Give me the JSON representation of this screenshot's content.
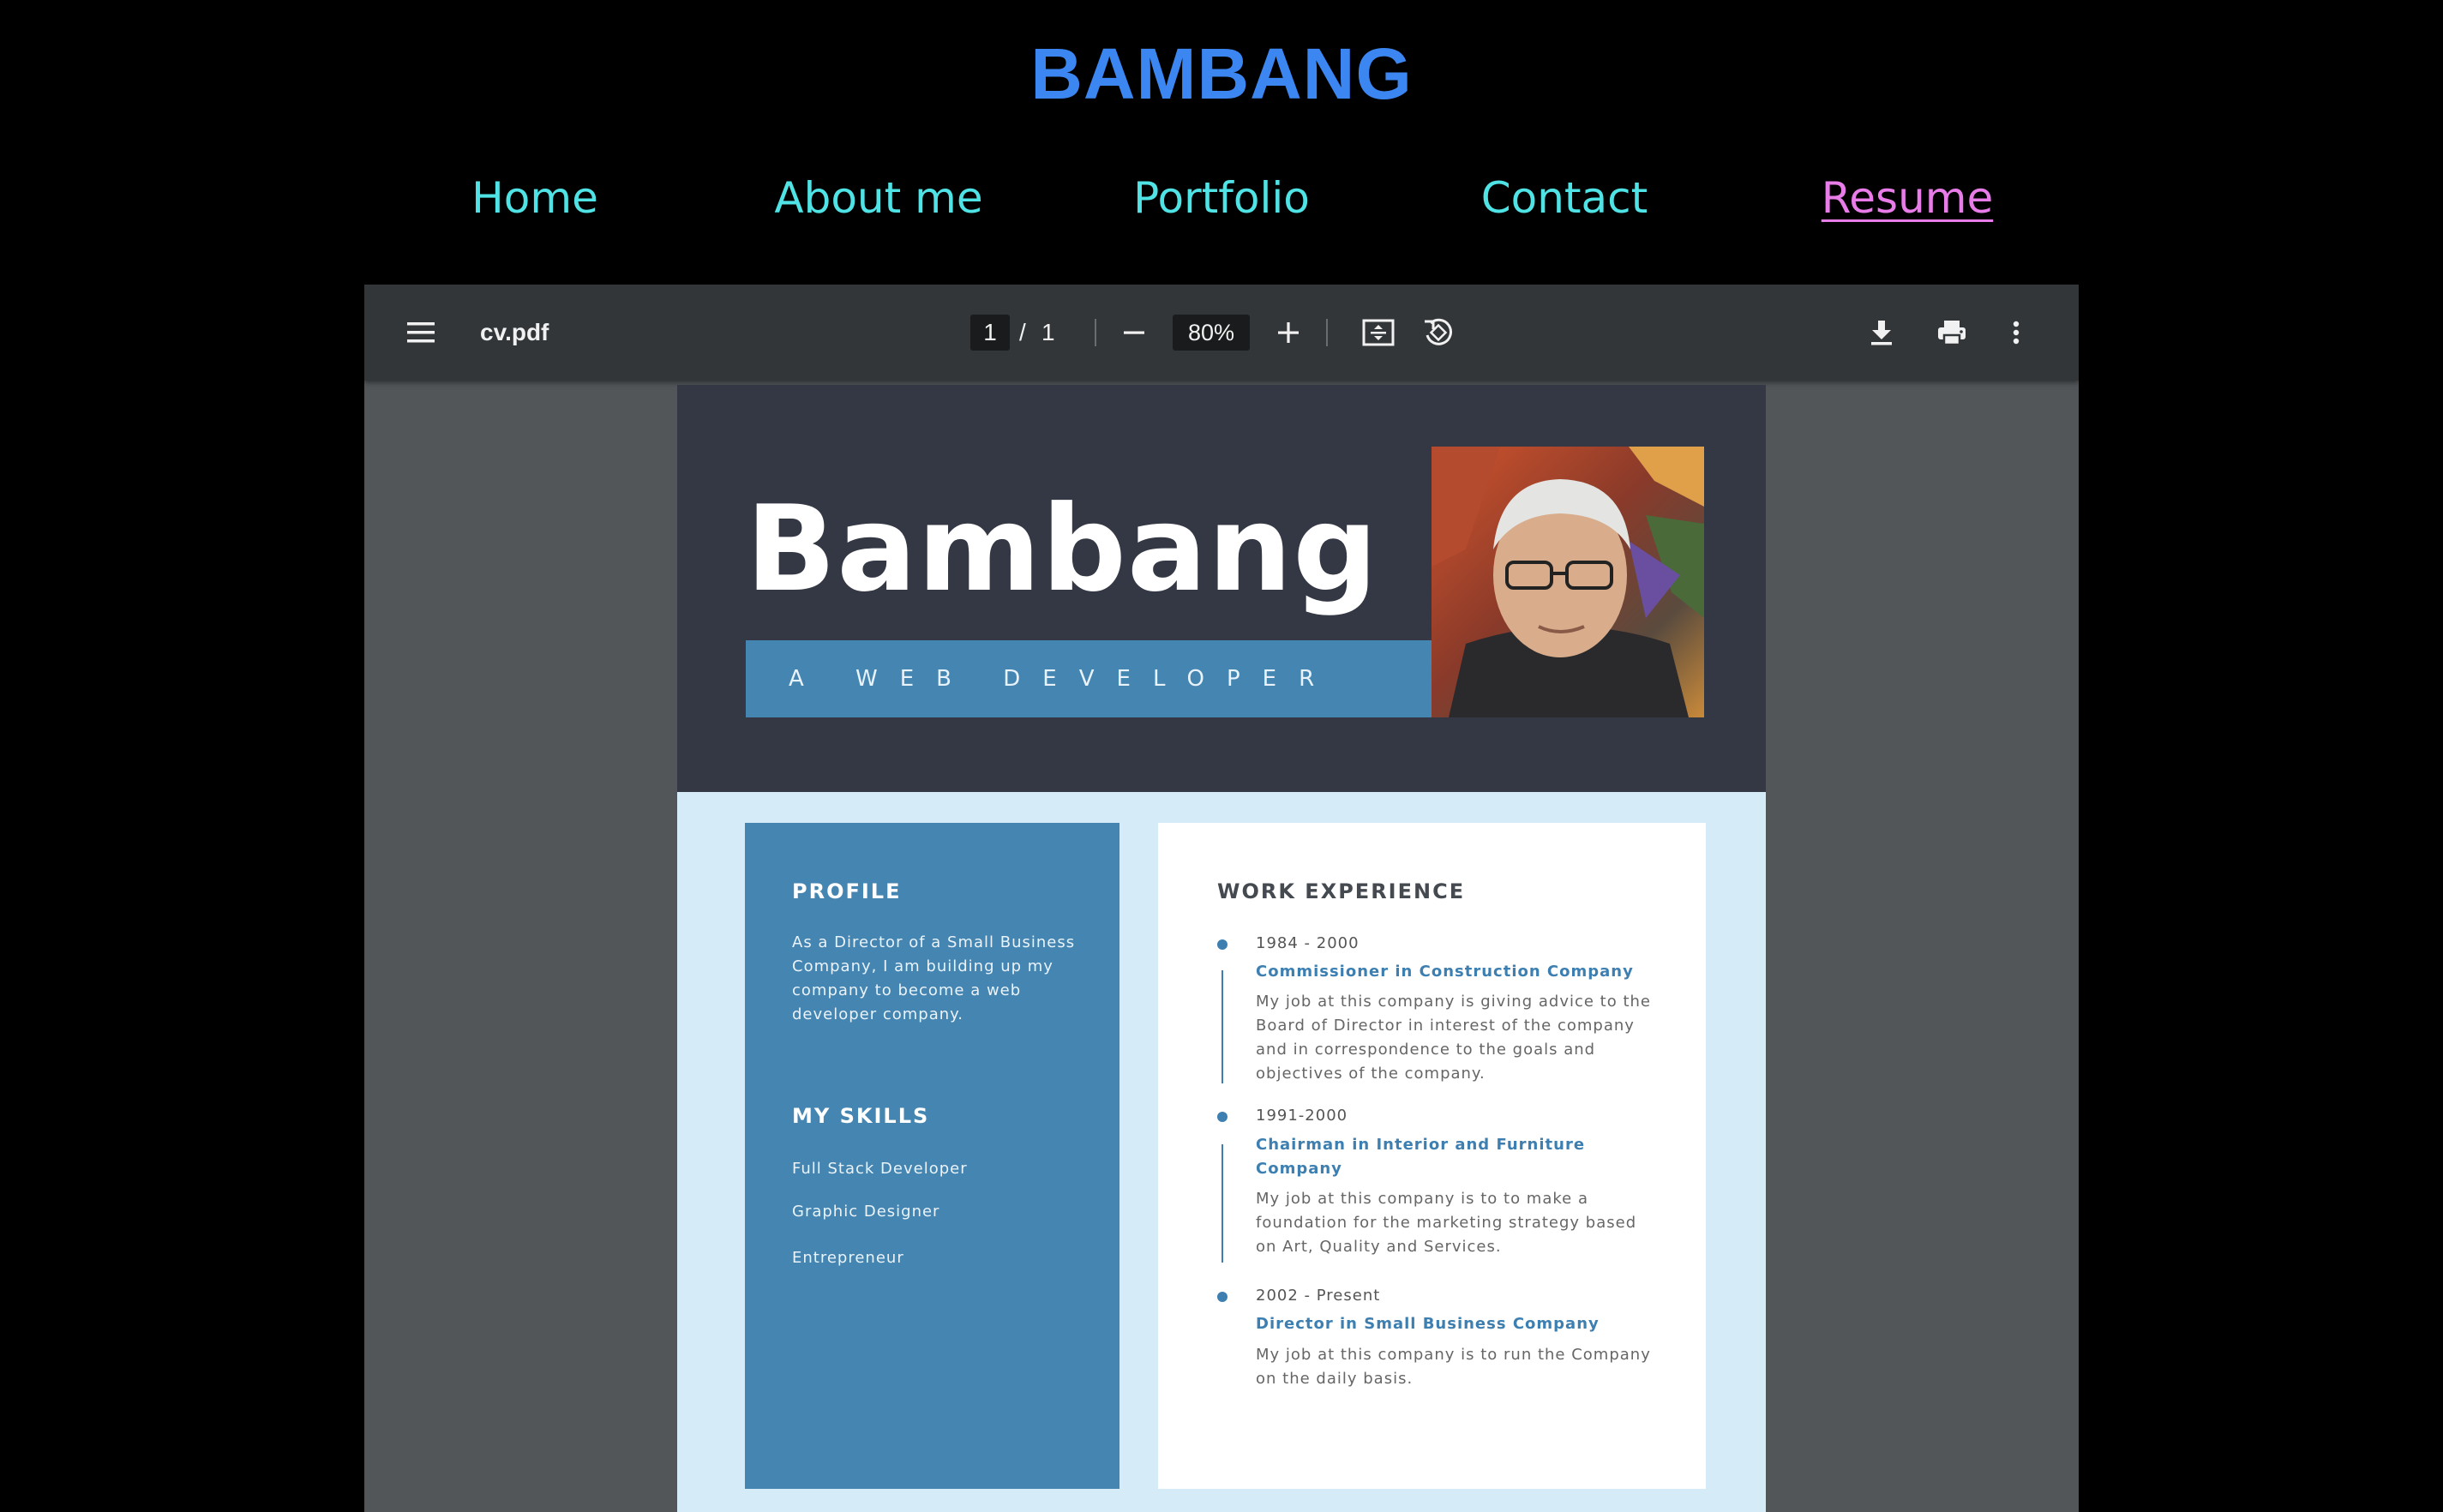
{
  "site": {
    "title": "BAMBANG"
  },
  "nav": {
    "items": [
      {
        "label": "Home",
        "active": false
      },
      {
        "label": "About me",
        "active": false
      },
      {
        "label": "Portfolio",
        "active": false
      },
      {
        "label": "Contact",
        "active": false
      },
      {
        "label": "Resume",
        "active": true
      }
    ]
  },
  "viewer": {
    "filename": "cv.pdf",
    "page_current": "1",
    "page_separator": "/",
    "page_total": "1",
    "zoom": "80%",
    "icons": [
      "menu-icon",
      "zoom-out-icon",
      "zoom-in-icon",
      "fit-page-icon",
      "rotate-icon",
      "download-icon",
      "print-icon",
      "more-options-icon"
    ]
  },
  "resume": {
    "name": "Bambang",
    "role": "A WEB DEVELOPER",
    "profile": {
      "title": "PROFILE",
      "text": "As a Director of a Small Business Company, I am building up my company to become a web developer company."
    },
    "skills": {
      "title": "MY SKILLS",
      "items": [
        "Full Stack Developer",
        "Graphic Designer",
        "Entrepreneur"
      ]
    },
    "work": {
      "title": "WORK EXPERIENCE",
      "jobs": [
        {
          "date": "1984 - 2000",
          "title": "Commissioner in Construction Company",
          "desc": "My job at this company is giving advice to the Board of Director in interest of the company and in correspondence to the goals and objectives of the company."
        },
        {
          "date": "1991-2000",
          "title": "Chairman in Interior and Furniture Company",
          "desc": "My job at this company is to to make a foundation for the marketing strategy based on Art, Quality and Services."
        },
        {
          "date": "2002 - Present",
          "title": "Director in Small Business Company",
          "desc": "My job at this company is to run the Company on the daily basis."
        }
      ]
    }
  },
  "colors": {
    "title_blue": "#3c86f2",
    "nav_cyan": "#4fe3e6",
    "nav_active_pink": "#e87ce8",
    "toolbar": "#323639",
    "viewer_bg": "#525659",
    "hero_dark": "#343844",
    "accent_blue": "#4485b1",
    "page_light_blue": "#d5ebf7"
  }
}
